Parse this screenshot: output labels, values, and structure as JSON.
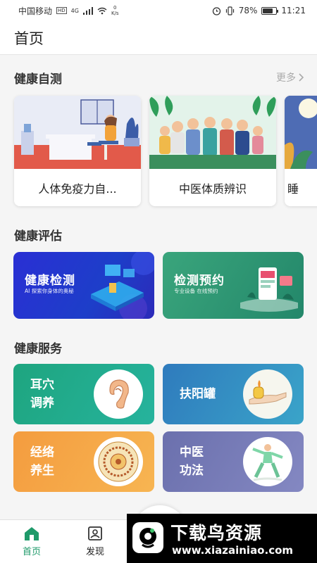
{
  "status": {
    "carrier": "中国移动",
    "hd": "HD",
    "network": "4G",
    "speed_value": "0",
    "speed_unit": "K/s",
    "battery": "78%",
    "battery_level": 0.78,
    "time": "11:21"
  },
  "appbar": {
    "title": "首页"
  },
  "self_test": {
    "title": "健康自测",
    "more": "更多",
    "cards": [
      {
        "label": "人体免疫力自..."
      },
      {
        "label": "中医体质辨识"
      },
      {
        "label": "睡"
      }
    ]
  },
  "evaluation": {
    "title": "健康评估",
    "cards": [
      {
        "title": "健康检测",
        "subtitle": "AI 探索你身体的奥秘"
      },
      {
        "title": "检测预约",
        "subtitle": "专业设备  在线预约"
      }
    ]
  },
  "services": {
    "title": "健康服务",
    "cards": [
      {
        "label": "耳穴\n调养"
      },
      {
        "label": "扶阳罐"
      },
      {
        "label": "经络\n养生"
      },
      {
        "label": "中医\n功法"
      }
    ]
  },
  "tabs": [
    {
      "label": "首页"
    },
    {
      "label": "发现"
    }
  ],
  "watermark": {
    "text": "下载鸟资源",
    "url": "www.xiazainiao.com"
  },
  "colors": {
    "accent": "#1f9a6a",
    "eval_blue": "#2b35d8",
    "eval_green": "#2f9a76",
    "svc_teal": "#22a88c",
    "svc_blue": "#2e87bd",
    "svc_orange": "#f6a545",
    "svc_purple": "#7579b4"
  }
}
